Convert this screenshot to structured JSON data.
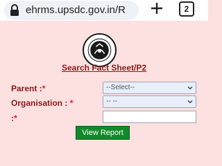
{
  "browser": {
    "url": "ehrms.upsdc.gov.in/R",
    "tab_count": "2"
  },
  "page": {
    "title": "Search Fact Sheet/P2"
  },
  "form": {
    "parent_label": "Parent :",
    "parent_req": "*",
    "parent_value": "--Select--",
    "organisation_label": "Organisation : ",
    "organisation_req": "*",
    "organisation_value": "-- --",
    "third_label": ":",
    "third_req": "*",
    "third_value": ""
  },
  "actions": {
    "view_report_label": "View Report"
  },
  "colors": {
    "page_bg": "#fde0e0",
    "label": "#8b1a1a",
    "required": "#e02020",
    "button_bg": "#138a2a"
  },
  "icons": [
    "lock-icon",
    "plus-icon",
    "tab-count-icon",
    "chevron-down-icon",
    "state-emblem"
  ]
}
